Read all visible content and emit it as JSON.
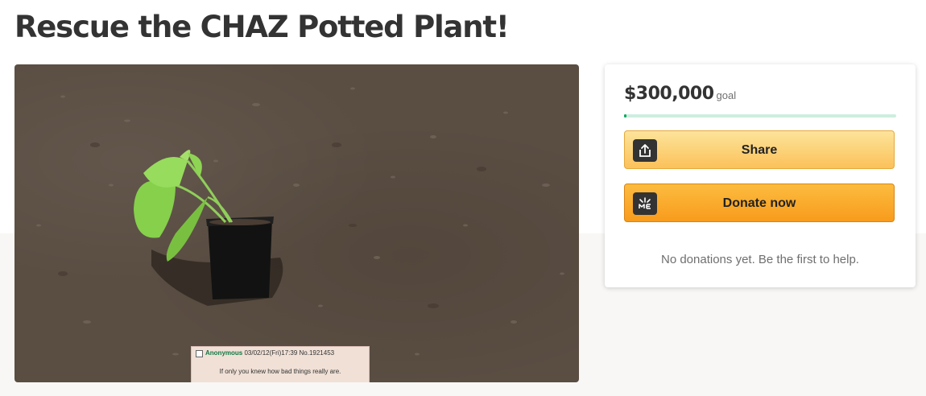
{
  "page": {
    "title": "Rescue the CHAZ Potted Plant!"
  },
  "hero_image": {
    "description_icon": "potted-plant-photo",
    "caption": {
      "name": "Anonymous",
      "meta": "03/02/12(Fri)17:39 No.1921453",
      "text": "If only you knew how bad things really are."
    }
  },
  "donation_card": {
    "amount": "$300,000",
    "goal_label": "goal",
    "progress_fraction": 0.01,
    "share_label": "Share",
    "share_icon": "share-upload-icon",
    "donate_label": "Donate now",
    "donate_icon": "gofundme-me-icon",
    "no_donations_text": "No donations yet. Be the first to help."
  },
  "colors": {
    "brand_green": "#02a95c",
    "share_button": "#fcd77a",
    "donate_button": "#f9a826",
    "title_text": "#333333"
  }
}
